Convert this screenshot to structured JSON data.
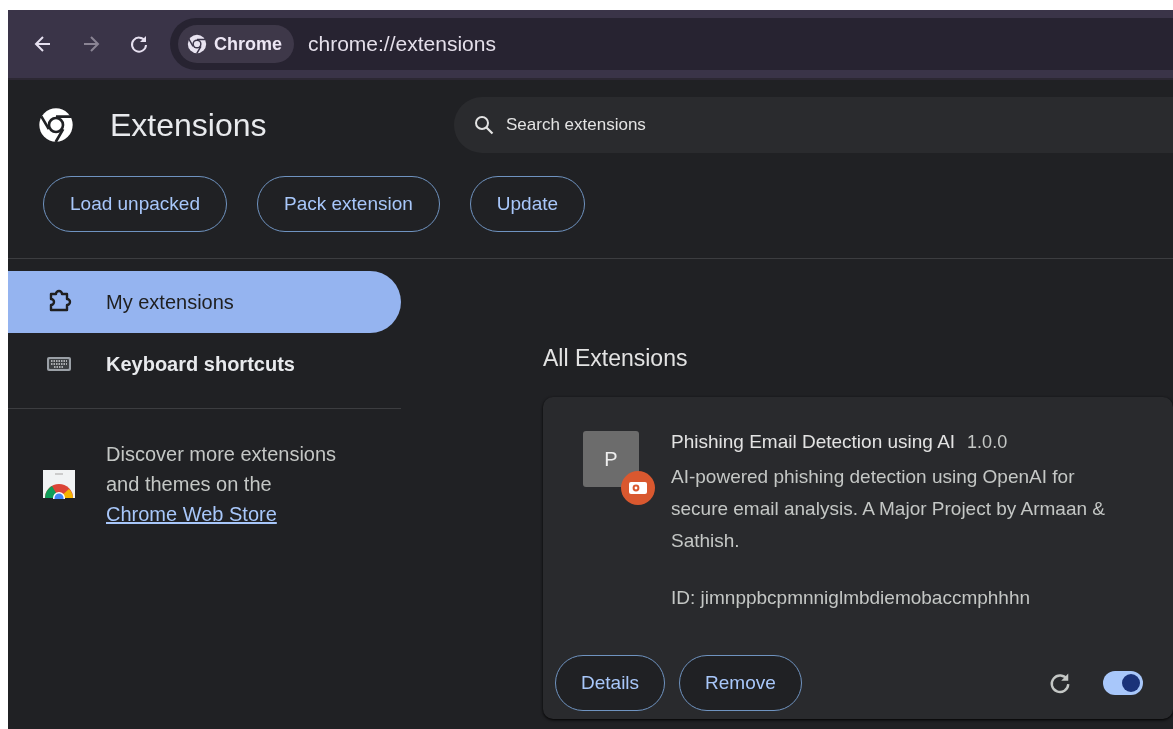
{
  "toolbar": {
    "nav": [
      {
        "kind": "back",
        "disabled": false
      },
      {
        "kind": "forward",
        "disabled": true
      },
      {
        "kind": "reload",
        "disabled": false
      }
    ],
    "chip": "Chrome",
    "url": "chrome://extensions"
  },
  "header": {
    "title": "Extensions",
    "search": {
      "placeholder": "Search extensions"
    },
    "buttons": [
      "Load unpacked",
      "Pack extension",
      "Update"
    ]
  },
  "sidebar": {
    "items": [
      {
        "kind": "puzzle",
        "label": "My extensions",
        "selected": true
      },
      {
        "kind": "keyboard",
        "label": "Keyboard shortcuts",
        "selected": false
      }
    ],
    "discover_text": "Discover more extensions and themes on the ",
    "discover_link": "Chrome Web Store"
  },
  "section_title": "All Extensions",
  "extension": {
    "icon_letter": "P",
    "name": "Phishing Email Detection using AI",
    "version": "1.0.0",
    "description": "AI-powered phishing detection using OpenAI for secure email analysis. A Major Project by Armaan & Sathish.",
    "id": "ID: jimnppbcpmnniglmbdiemobaccmphhhn",
    "buttons": [
      "Details",
      "Remove"
    ],
    "enabled": true
  }
}
